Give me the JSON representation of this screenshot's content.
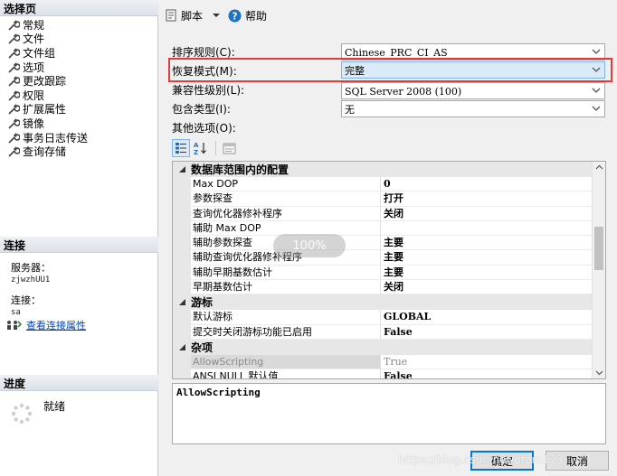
{
  "left": {
    "select_page_title": "选择页",
    "nav_items": [
      {
        "label": "常规"
      },
      {
        "label": "文件"
      },
      {
        "label": "文件组"
      },
      {
        "label": "选项"
      },
      {
        "label": "更改跟踪"
      },
      {
        "label": "权限"
      },
      {
        "label": "扩展属性"
      },
      {
        "label": "镜像"
      },
      {
        "label": "事务日志传送"
      },
      {
        "label": "查询存储"
      }
    ],
    "connection_title": "连接",
    "server_label": "服务器：",
    "server_value": "zjwzhUU1",
    "conn_label": "连接：",
    "conn_value": "sa",
    "view_conn_props": "查看连接属性",
    "progress_title": "进度",
    "progress_status": "就绪"
  },
  "toolbar": {
    "script_label": "脚本",
    "help_label": "帮助"
  },
  "form": {
    "collation_label": "排序规则(C):",
    "collation_value": "Chinese_PRC_CI_AS",
    "recovery_label": "恢复模式(M):",
    "recovery_value": "完整",
    "compat_label": "兼容性级别(L):",
    "compat_value": "SQL Server 2008 (100)",
    "containment_label": "包含类型(I):",
    "containment_value": "无",
    "other_options_label": "其他选项(O):"
  },
  "grid": {
    "cat1": "数据库范围内的配置",
    "cat1_rows": [
      {
        "k": "Max DOP",
        "v": "0"
      },
      {
        "k": "参数探查",
        "v": "打开"
      },
      {
        "k": "查询优化器修补程序",
        "v": "关闭"
      },
      {
        "k": "辅助 Max DOP",
        "v": ""
      },
      {
        "k": "辅助参数探查",
        "v": "主要"
      },
      {
        "k": "辅助查询优化器修补程序",
        "v": "主要"
      },
      {
        "k": "辅助早期基数估计",
        "v": "主要"
      },
      {
        "k": "早期基数估计",
        "v": "关闭"
      }
    ],
    "cat2": "游标",
    "cat2_rows": [
      {
        "k": "默认游标",
        "v": "GLOBAL"
      },
      {
        "k": "提交时关闭游标功能已启用",
        "v": "False"
      }
    ],
    "cat3": "杂项",
    "cat3_rows": [
      {
        "k": "AllowScripting",
        "v": "True"
      },
      {
        "k": "ANSI NULL 默认值",
        "v": "False"
      }
    ],
    "zoom_badge": "100%"
  },
  "description": "AllowScripting",
  "buttons": {
    "ok": "确定",
    "cancel": "取消"
  },
  "watermark": "https://blog.csdn.net/pfarn123",
  "colors": {
    "highlight": "#e23b3b",
    "selection": "#dbeaf8",
    "link": "#0645ad"
  }
}
